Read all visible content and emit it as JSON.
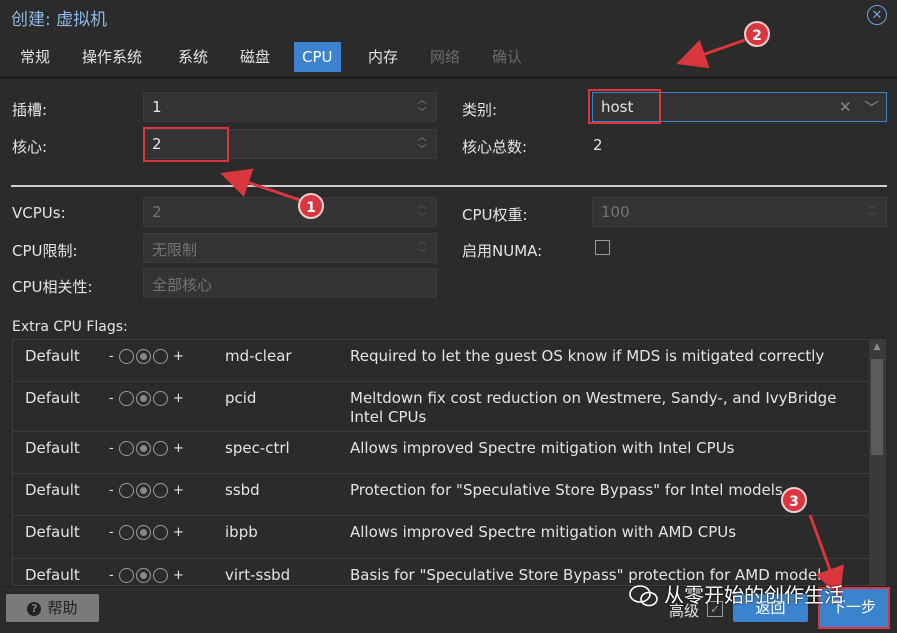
{
  "window": {
    "title": "创建: 虚拟机"
  },
  "tabs": [
    {
      "label": "常规",
      "state": "normal"
    },
    {
      "label": "操作系统",
      "state": "normal"
    },
    {
      "label": "系统",
      "state": "normal"
    },
    {
      "label": "磁盘",
      "state": "normal"
    },
    {
      "label": "CPU",
      "state": "active"
    },
    {
      "label": "内存",
      "state": "normal"
    },
    {
      "label": "网络",
      "state": "disabled"
    },
    {
      "label": "确认",
      "state": "disabled"
    }
  ],
  "form": {
    "sockets": {
      "label": "插槽:",
      "value": "1"
    },
    "cores": {
      "label": "核心:",
      "value": "2"
    },
    "type": {
      "label": "类别:",
      "value": "host"
    },
    "total_cores": {
      "label": "核心总数:",
      "value": "2"
    },
    "vcpus": {
      "label": "VCPUs:",
      "value": "2"
    },
    "cpu_weight": {
      "label": "CPU权重:",
      "value": "100"
    },
    "cpu_limit": {
      "label": "CPU限制:",
      "value": "无限制"
    },
    "numa": {
      "label": "启用NUMA:",
      "checked": false
    },
    "affinity": {
      "label": "CPU相关性:",
      "placeholder": "全部核心"
    }
  },
  "flags": {
    "title": "Extra CPU Flags:",
    "minus": "-",
    "plus": "+",
    "rows": [
      {
        "state": "Default",
        "flag": "md-clear",
        "desc": "Required to let the guest OS know if MDS is mitigated correctly"
      },
      {
        "state": "Default",
        "flag": "pcid",
        "desc": "Meltdown fix cost reduction on Westmere, Sandy-, and IvyBridge Intel CPUs"
      },
      {
        "state": "Default",
        "flag": "spec-ctrl",
        "desc": "Allows improved Spectre mitigation with Intel CPUs"
      },
      {
        "state": "Default",
        "flag": "ssbd",
        "desc": "Protection for \"Speculative Store Bypass\" for Intel models"
      },
      {
        "state": "Default",
        "flag": "ibpb",
        "desc": "Allows improved Spectre mitigation with AMD CPUs"
      },
      {
        "state": "Default",
        "flag": "virt-ssbd",
        "desc": "Basis for \"Speculative Store Bypass\" protection for AMD models"
      }
    ]
  },
  "footer": {
    "help": "帮助",
    "advanced": "高级",
    "advanced_checked": true,
    "back": "返回",
    "next": "下一步"
  },
  "annotations": {
    "badge1": "1",
    "badge2": "2",
    "badge3": "3"
  },
  "watermark": "从零开始的创作生活",
  "colors": {
    "accent": "#3b83cc",
    "highlight": "#d9363e",
    "background": "#2b2b2b"
  }
}
